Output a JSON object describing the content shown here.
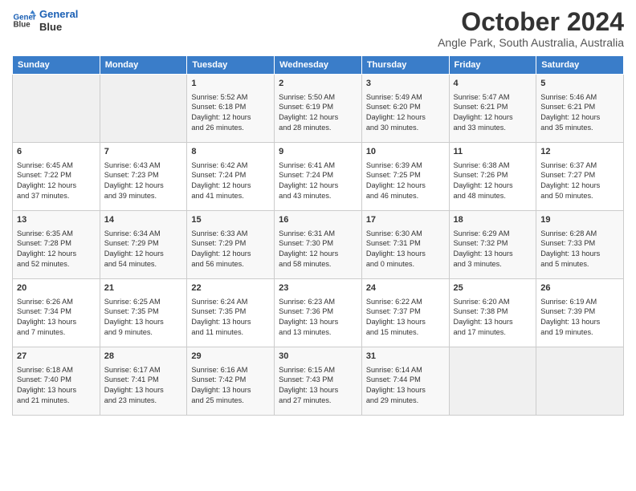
{
  "header": {
    "logo_line1": "General",
    "logo_line2": "Blue",
    "month_title": "October 2024",
    "location": "Angle Park, South Australia, Australia"
  },
  "days_of_week": [
    "Sunday",
    "Monday",
    "Tuesday",
    "Wednesday",
    "Thursday",
    "Friday",
    "Saturday"
  ],
  "weeks": [
    [
      {
        "day": "",
        "content": ""
      },
      {
        "day": "",
        "content": ""
      },
      {
        "day": "1",
        "content": "Sunrise: 5:52 AM\nSunset: 6:18 PM\nDaylight: 12 hours\nand 26 minutes."
      },
      {
        "day": "2",
        "content": "Sunrise: 5:50 AM\nSunset: 6:19 PM\nDaylight: 12 hours\nand 28 minutes."
      },
      {
        "day": "3",
        "content": "Sunrise: 5:49 AM\nSunset: 6:20 PM\nDaylight: 12 hours\nand 30 minutes."
      },
      {
        "day": "4",
        "content": "Sunrise: 5:47 AM\nSunset: 6:21 PM\nDaylight: 12 hours\nand 33 minutes."
      },
      {
        "day": "5",
        "content": "Sunrise: 5:46 AM\nSunset: 6:21 PM\nDaylight: 12 hours\nand 35 minutes."
      }
    ],
    [
      {
        "day": "6",
        "content": "Sunrise: 6:45 AM\nSunset: 7:22 PM\nDaylight: 12 hours\nand 37 minutes."
      },
      {
        "day": "7",
        "content": "Sunrise: 6:43 AM\nSunset: 7:23 PM\nDaylight: 12 hours\nand 39 minutes."
      },
      {
        "day": "8",
        "content": "Sunrise: 6:42 AM\nSunset: 7:24 PM\nDaylight: 12 hours\nand 41 minutes."
      },
      {
        "day": "9",
        "content": "Sunrise: 6:41 AM\nSunset: 7:24 PM\nDaylight: 12 hours\nand 43 minutes."
      },
      {
        "day": "10",
        "content": "Sunrise: 6:39 AM\nSunset: 7:25 PM\nDaylight: 12 hours\nand 46 minutes."
      },
      {
        "day": "11",
        "content": "Sunrise: 6:38 AM\nSunset: 7:26 PM\nDaylight: 12 hours\nand 48 minutes."
      },
      {
        "day": "12",
        "content": "Sunrise: 6:37 AM\nSunset: 7:27 PM\nDaylight: 12 hours\nand 50 minutes."
      }
    ],
    [
      {
        "day": "13",
        "content": "Sunrise: 6:35 AM\nSunset: 7:28 PM\nDaylight: 12 hours\nand 52 minutes."
      },
      {
        "day": "14",
        "content": "Sunrise: 6:34 AM\nSunset: 7:29 PM\nDaylight: 12 hours\nand 54 minutes."
      },
      {
        "day": "15",
        "content": "Sunrise: 6:33 AM\nSunset: 7:29 PM\nDaylight: 12 hours\nand 56 minutes."
      },
      {
        "day": "16",
        "content": "Sunrise: 6:31 AM\nSunset: 7:30 PM\nDaylight: 12 hours\nand 58 minutes."
      },
      {
        "day": "17",
        "content": "Sunrise: 6:30 AM\nSunset: 7:31 PM\nDaylight: 13 hours\nand 0 minutes."
      },
      {
        "day": "18",
        "content": "Sunrise: 6:29 AM\nSunset: 7:32 PM\nDaylight: 13 hours\nand 3 minutes."
      },
      {
        "day": "19",
        "content": "Sunrise: 6:28 AM\nSunset: 7:33 PM\nDaylight: 13 hours\nand 5 minutes."
      }
    ],
    [
      {
        "day": "20",
        "content": "Sunrise: 6:26 AM\nSunset: 7:34 PM\nDaylight: 13 hours\nand 7 minutes."
      },
      {
        "day": "21",
        "content": "Sunrise: 6:25 AM\nSunset: 7:35 PM\nDaylight: 13 hours\nand 9 minutes."
      },
      {
        "day": "22",
        "content": "Sunrise: 6:24 AM\nSunset: 7:35 PM\nDaylight: 13 hours\nand 11 minutes."
      },
      {
        "day": "23",
        "content": "Sunrise: 6:23 AM\nSunset: 7:36 PM\nDaylight: 13 hours\nand 13 minutes."
      },
      {
        "day": "24",
        "content": "Sunrise: 6:22 AM\nSunset: 7:37 PM\nDaylight: 13 hours\nand 15 minutes."
      },
      {
        "day": "25",
        "content": "Sunrise: 6:20 AM\nSunset: 7:38 PM\nDaylight: 13 hours\nand 17 minutes."
      },
      {
        "day": "26",
        "content": "Sunrise: 6:19 AM\nSunset: 7:39 PM\nDaylight: 13 hours\nand 19 minutes."
      }
    ],
    [
      {
        "day": "27",
        "content": "Sunrise: 6:18 AM\nSunset: 7:40 PM\nDaylight: 13 hours\nand 21 minutes."
      },
      {
        "day": "28",
        "content": "Sunrise: 6:17 AM\nSunset: 7:41 PM\nDaylight: 13 hours\nand 23 minutes."
      },
      {
        "day": "29",
        "content": "Sunrise: 6:16 AM\nSunset: 7:42 PM\nDaylight: 13 hours\nand 25 minutes."
      },
      {
        "day": "30",
        "content": "Sunrise: 6:15 AM\nSunset: 7:43 PM\nDaylight: 13 hours\nand 27 minutes."
      },
      {
        "day": "31",
        "content": "Sunrise: 6:14 AM\nSunset: 7:44 PM\nDaylight: 13 hours\nand 29 minutes."
      },
      {
        "day": "",
        "content": ""
      },
      {
        "day": "",
        "content": ""
      }
    ]
  ]
}
